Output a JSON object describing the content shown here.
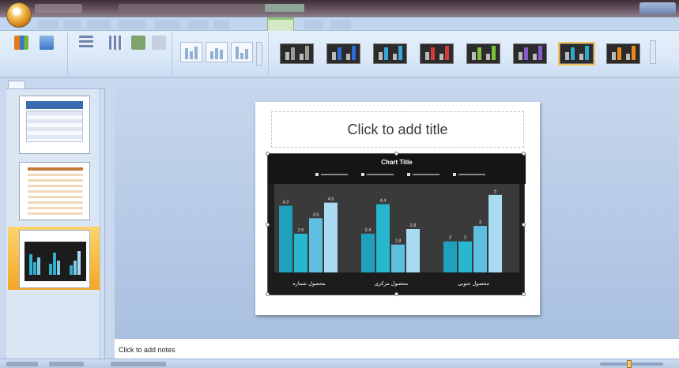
{
  "window": {
    "colors": {
      "accent": "#f1c35a",
      "chart_bg": "#2a2a2a"
    }
  },
  "ribbon": {
    "active_tab_index": 0,
    "chart_styles": [
      {
        "color": "#9a9a9a"
      },
      {
        "color": "#2d6bd8"
      },
      {
        "color": "#3aa6d6"
      },
      {
        "color": "#d83a3a"
      },
      {
        "color": "#7ec03a"
      },
      {
        "color": "#8a5ad0"
      },
      {
        "color": "#2fa9c9"
      },
      {
        "color": "#e88a1a"
      }
    ],
    "selected_style_index": 6
  },
  "slides_pane": {
    "slides": [
      {
        "number": ""
      },
      {
        "number": ""
      },
      {
        "number": ""
      }
    ],
    "selected_index": 2
  },
  "slide": {
    "title_placeholder": "Click to add title",
    "chart_data": {
      "type": "bar",
      "title": "Chart Title",
      "categories": [
        "محصول شماره",
        "محصول مرکزی",
        "محصول جنوبی"
      ],
      "series": [
        {
          "color": "#1fa1bd",
          "values": [
            4.3,
            2.5,
            2
          ]
        },
        {
          "color": "#27b7cf",
          "values": [
            2.5,
            4.4,
            2
          ]
        },
        {
          "color": "#5fbfe0",
          "values": [
            3.5,
            1.8,
            3
          ]
        },
        {
          "color": "#a9dcf3",
          "values": [
            4.5,
            2.8,
            5
          ]
        }
      ],
      "data_labels": [
        [
          "4.3",
          "2.5",
          "3.5",
          "4.5"
        ],
        [
          "2.4",
          "4.4",
          "1.8",
          "2.8"
        ],
        [
          "2",
          "2",
          "3",
          "5"
        ]
      ],
      "ylim": [
        0,
        5.5
      ],
      "legend_position": "top"
    }
  },
  "notes": {
    "placeholder": "Click to add notes"
  }
}
